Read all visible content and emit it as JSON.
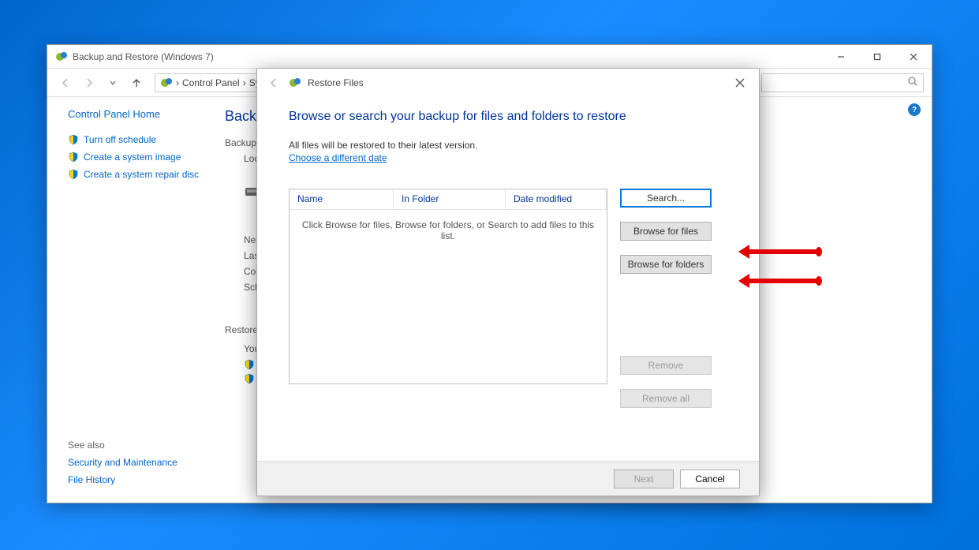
{
  "parent_window": {
    "title": "Backup and Restore (Windows 7)",
    "breadcrumb": {
      "part1": "Control Panel",
      "part2": "Sys"
    },
    "left_panel": {
      "home": "Control Panel Home",
      "tasks": [
        "Turn off schedule",
        "Create a system image",
        "Create a system repair disc"
      ],
      "see_also": {
        "heading": "See also",
        "links": [
          "Security and Maintenance",
          "File History"
        ]
      }
    },
    "main": {
      "heading": "Back",
      "backup_label": "Backup",
      "loc": "Loc",
      "info_lines": [
        "Nex",
        "Las",
        "Cor",
        "Sch"
      ],
      "restore_label": "Restore",
      "you": "You"
    }
  },
  "dialog": {
    "title": "Restore Files",
    "heading": "Browse or search your backup for files and folders to restore",
    "subtext": "All files will be restored to their latest version.",
    "link": "Choose a different date",
    "columns": {
      "name": "Name",
      "folder": "In Folder",
      "date": "Date modified"
    },
    "empty_text": "Click Browse for files, Browse for folders, or Search to add files to this list.",
    "buttons": {
      "search": "Search...",
      "browse_files": "Browse for files",
      "browse_folders": "Browse for folders",
      "remove": "Remove",
      "remove_all": "Remove all"
    },
    "footer": {
      "next": "Next",
      "cancel": "Cancel"
    }
  }
}
